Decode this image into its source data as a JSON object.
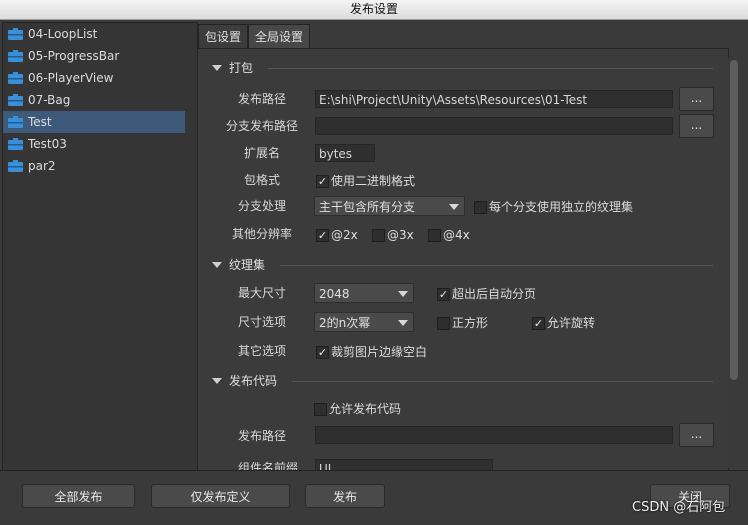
{
  "window": {
    "title": "发布设置"
  },
  "packages": [
    "04-LoopList",
    "05-ProgressBar",
    "06-PlayerView",
    "07-Bag",
    "Test",
    "Test03",
    "par2"
  ],
  "selected_package": "Test",
  "tabs": [
    "包设置",
    "全局设置"
  ],
  "active_tab": "全局设置",
  "pack": {
    "section_title": "打包",
    "publish_path_label": "发布路径",
    "publish_path_value": "E:\\shi\\Project\\Unity\\Assets\\Resources\\01-Test",
    "branch_path_label": "分支发布路径",
    "branch_path_value": "",
    "ext_label": "扩展名",
    "ext_value": "bytes",
    "format_label": "包格式",
    "format_check_label": "使用二进制格式",
    "branch_label": "分支处理",
    "branch_option": "主干包含所有分支",
    "branch_atlas_check_label": "每个分支使用独立的纹理集",
    "resolution_label": "其他分辨率",
    "res_2x": "@2x",
    "res_3x": "@3x",
    "res_4x": "@4x"
  },
  "atlas": {
    "section_title": "纹理集",
    "max_size_label": "最大尺寸",
    "max_size_value": "2048",
    "auto_page_label": "超出后自动分页",
    "size_opt_label": "尺寸选项",
    "size_opt_value": "2的n次幂",
    "square_label": "正方形",
    "rotate_label": "允许旋转",
    "other_label": "其它选项",
    "trim_label": "裁剪图片边缘空白"
  },
  "code": {
    "section_title": "发布代码",
    "allow_label": "允许发布代码",
    "path_label": "发布路径",
    "path_value": "",
    "prefix_label": "组件名前缀",
    "prefix_value": "UI"
  },
  "browse_label": "...",
  "footer": {
    "publish_all": "全部发布",
    "publish_def": "仅发布定义",
    "publish": "发布",
    "close": "关闭"
  },
  "watermark": "CSDN @石阿包",
  "colors": {
    "selection": "#3e5a7a",
    "package_icon": "#3b8fd6"
  }
}
